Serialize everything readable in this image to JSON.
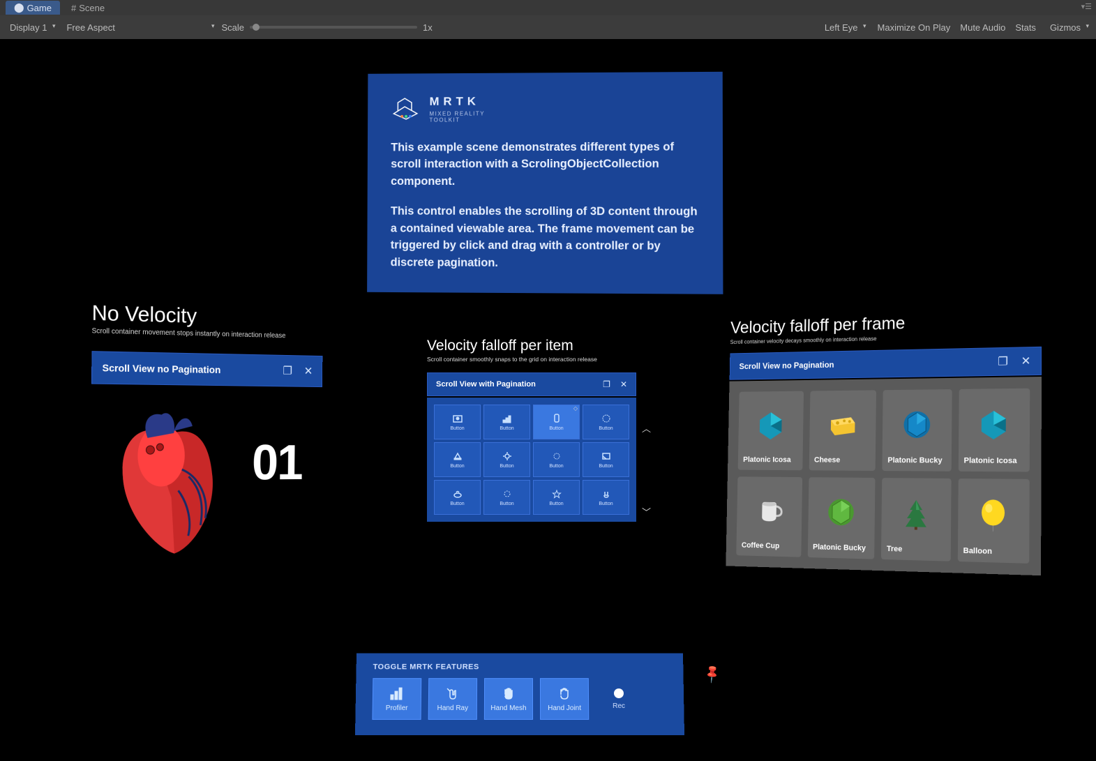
{
  "tabs": {
    "game": "Game",
    "scene": "Scene"
  },
  "toolbar": {
    "display": "Display 1",
    "aspect": "Free Aspect",
    "scale_label": "Scale",
    "scale_value": "1x",
    "eye": "Left Eye",
    "maximize": "Maximize On Play",
    "mute": "Mute Audio",
    "stats": "Stats",
    "gizmos": "Gizmos"
  },
  "info": {
    "title": "MRTK",
    "sub1": "MIXED REALITY",
    "sub2": "TOOLKIT",
    "p1": "This example scene demonstrates different types of scroll interaction with a ScrolingObjectCollection component.",
    "p2": "This control enables the scrolling of 3D content through a contained viewable area. The frame movement can be triggered by click and drag with a controller or by discrete pagination."
  },
  "left": {
    "title": "No Velocity",
    "sub": "Scroll container movement stops instantly on interaction release",
    "bar": "Scroll View no Pagination",
    "counter": "01"
  },
  "mid": {
    "title": "Velocity falloff per item",
    "sub": "Scroll container smoothly snaps to the grid on interaction release",
    "bar": "Scroll View with Pagination",
    "btn": "Button"
  },
  "right": {
    "title": "Velocity falloff per frame",
    "sub": "Scroll container velocity decays smoothly on interaction release",
    "bar": "Scroll View no Pagination",
    "cards": [
      {
        "label": "Platonic Icosa"
      },
      {
        "label": "Cheese"
      },
      {
        "label": "Platonic Bucky"
      },
      {
        "label": "Platonic Icosa"
      },
      {
        "label": "Coffee Cup"
      },
      {
        "label": "Platonic Bucky"
      },
      {
        "label": "Tree"
      },
      {
        "label": "Balloon"
      }
    ]
  },
  "toggle": {
    "title": "TOGGLE MRTK FEATURES",
    "buttons": [
      {
        "label": "Profiler"
      },
      {
        "label": "Hand Ray"
      },
      {
        "label": "Hand Mesh"
      },
      {
        "label": "Hand Joint"
      }
    ],
    "rec": "Rec"
  }
}
